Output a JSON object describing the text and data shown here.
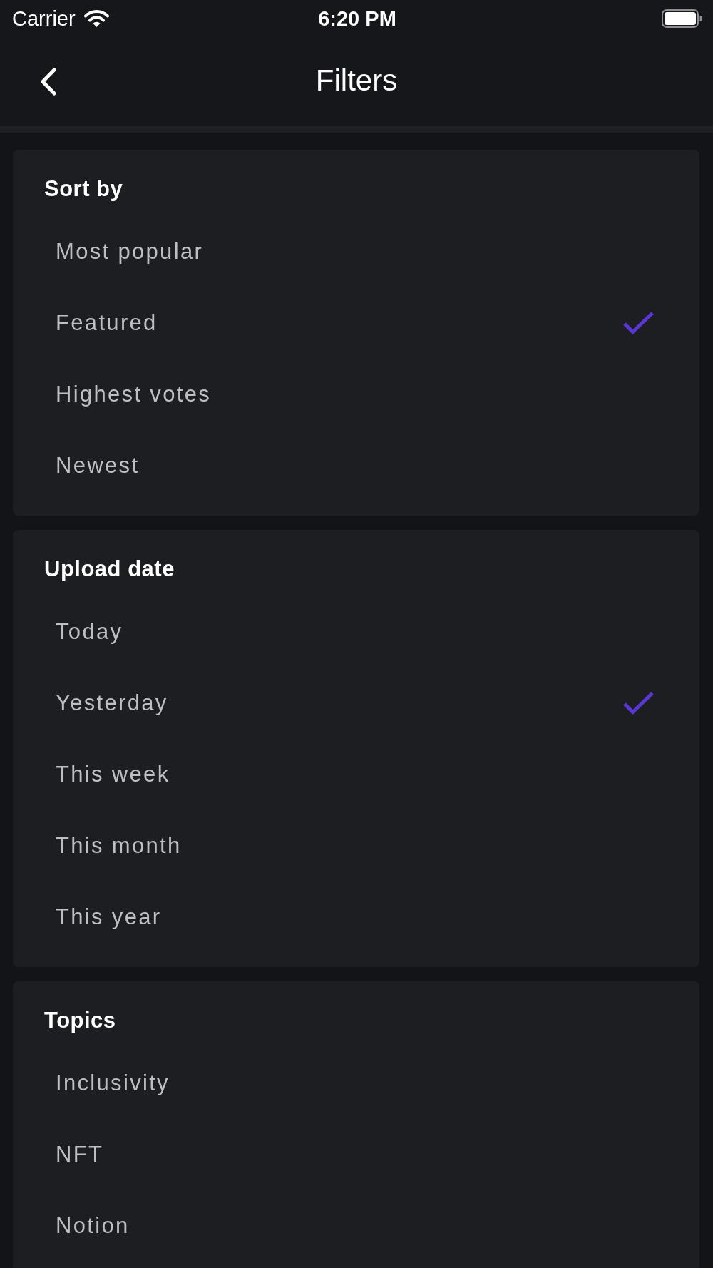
{
  "status_bar": {
    "carrier": "Carrier",
    "time": "6:20 PM"
  },
  "nav_bar": {
    "title": "Filters"
  },
  "sections": [
    {
      "title": "Sort by",
      "options": [
        {
          "label": "Most popular",
          "selected": false
        },
        {
          "label": "Featured",
          "selected": true
        },
        {
          "label": "Highest votes",
          "selected": false
        },
        {
          "label": "Newest",
          "selected": false
        }
      ]
    },
    {
      "title": "Upload date",
      "options": [
        {
          "label": "Today",
          "selected": false
        },
        {
          "label": "Yesterday",
          "selected": true
        },
        {
          "label": "This week",
          "selected": false
        },
        {
          "label": "This month",
          "selected": false
        },
        {
          "label": "This year",
          "selected": false
        }
      ]
    },
    {
      "title": "Topics",
      "options": [
        {
          "label": "Inclusivity",
          "selected": false
        },
        {
          "label": "NFT",
          "selected": false
        },
        {
          "label": "Notion",
          "selected": false
        }
      ]
    }
  ]
}
